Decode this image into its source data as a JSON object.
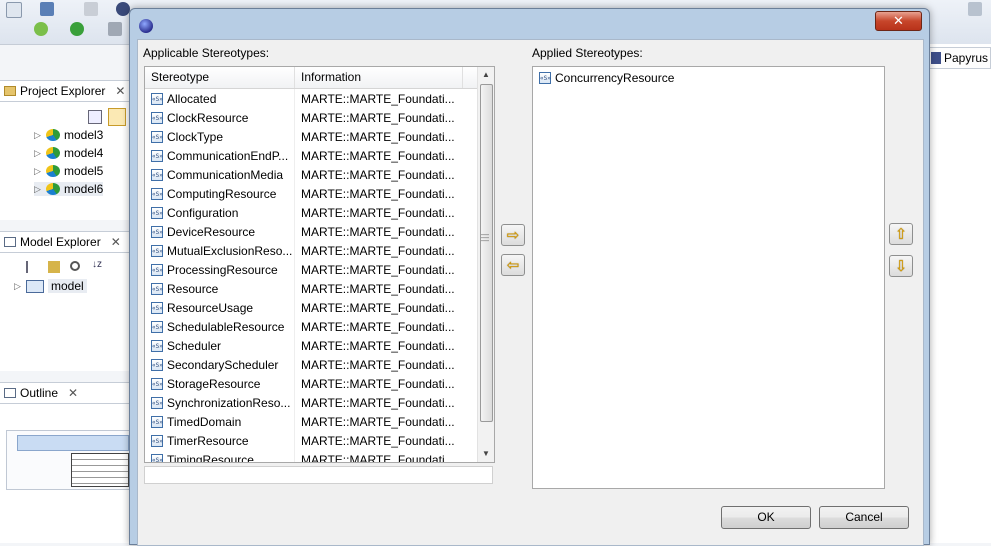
{
  "workbench": {
    "project_explorer_title": "Project Explorer",
    "project_models": [
      "model3",
      "model4",
      "model5",
      "model6"
    ],
    "model_explorer_title": "Model Explorer",
    "model_root": "model",
    "outline_title": "Outline",
    "perspective_label": "Papyrus"
  },
  "dialog": {
    "close_label": "✕",
    "applicable_label": "Applicable Stereotypes:",
    "applied_label": "Applied Stereotypes:",
    "columns": [
      "Stereotype",
      "Information"
    ],
    "stereotype_icon": "«S»",
    "rows": [
      {
        "name": "Allocated",
        "info": "MARTE::MARTE_Foundati..."
      },
      {
        "name": "ClockResource",
        "info": "MARTE::MARTE_Foundati..."
      },
      {
        "name": "ClockType",
        "info": "MARTE::MARTE_Foundati..."
      },
      {
        "name": "CommunicationEndP...",
        "info": "MARTE::MARTE_Foundati..."
      },
      {
        "name": "CommunicationMedia",
        "info": "MARTE::MARTE_Foundati..."
      },
      {
        "name": "ComputingResource",
        "info": "MARTE::MARTE_Foundati..."
      },
      {
        "name": "Configuration",
        "info": "MARTE::MARTE_Foundati..."
      },
      {
        "name": "DeviceResource",
        "info": "MARTE::MARTE_Foundati..."
      },
      {
        "name": "MutualExclusionReso...",
        "info": "MARTE::MARTE_Foundati..."
      },
      {
        "name": "ProcessingResource",
        "info": "MARTE::MARTE_Foundati..."
      },
      {
        "name": "Resource",
        "info": "MARTE::MARTE_Foundati..."
      },
      {
        "name": "ResourceUsage",
        "info": "MARTE::MARTE_Foundati..."
      },
      {
        "name": "SchedulableResource",
        "info": "MARTE::MARTE_Foundati..."
      },
      {
        "name": "Scheduler",
        "info": "MARTE::MARTE_Foundati..."
      },
      {
        "name": "SecondaryScheduler",
        "info": "MARTE::MARTE_Foundati..."
      },
      {
        "name": "StorageResource",
        "info": "MARTE::MARTE_Foundati..."
      },
      {
        "name": "SynchronizationReso...",
        "info": "MARTE::MARTE_Foundati..."
      },
      {
        "name": "TimedDomain",
        "info": "MARTE::MARTE_Foundati..."
      },
      {
        "name": "TimerResource",
        "info": "MARTE::MARTE_Foundati..."
      },
      {
        "name": "TimingResource",
        "info": "MARTE::MARTE_Foundati..."
      }
    ],
    "filter_value": "",
    "applied": [
      "ConcurrencyResource"
    ],
    "add_arrow": "⇨",
    "remove_arrow": "⇦",
    "up_arrow": "⇧",
    "down_arrow": "⇩",
    "ok_label": "OK",
    "cancel_label": "Cancel"
  }
}
